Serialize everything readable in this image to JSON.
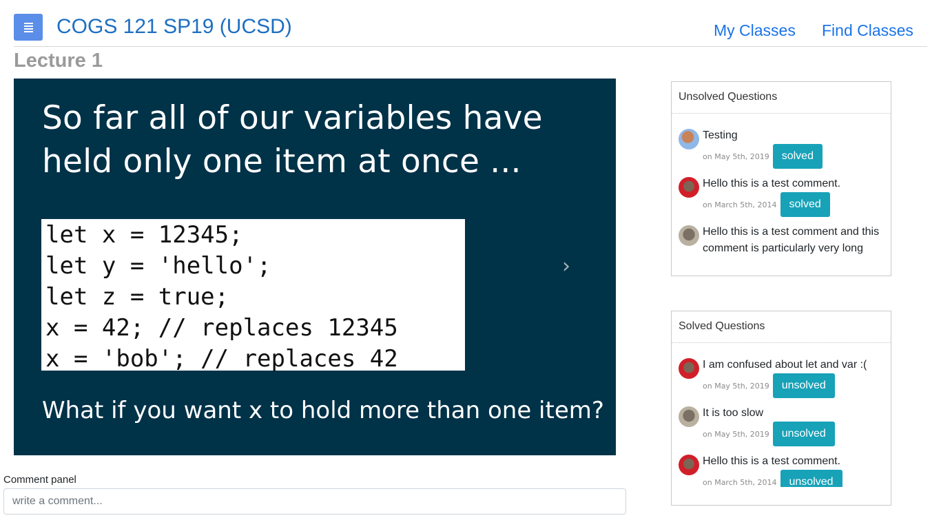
{
  "header": {
    "course_title": "COGS 121 SP19 (UCSD)",
    "nav": {
      "my_classes": "My Classes",
      "find_classes": "Find Classes"
    }
  },
  "lecture": {
    "title": "Lecture 1"
  },
  "slide": {
    "heading": "So far all of our variables have held only one item at once ...",
    "code_lines": [
      "let x = 12345;",
      "let y = 'hello';",
      "let z = true;",
      "x = 42; // replaces 12345",
      "x = 'bob'; // replaces 42"
    ],
    "question": "What if you want x to hold more than one item?",
    "next_icon": "chevron-right-icon"
  },
  "comment_panel": {
    "label": "Comment panel",
    "placeholder": "write a comment..."
  },
  "unsolved": {
    "title": "Unsolved Questions",
    "items": [
      {
        "text": "Testing",
        "date": "on May 5th, 2019",
        "button": "solved"
      },
      {
        "text": "Hello this is a test comment.",
        "date": "on March 5th, 2014",
        "button": "solved"
      },
      {
        "text": "Hello this is a test comment and this comment is particularly very long",
        "date": "",
        "button": ""
      }
    ]
  },
  "solved": {
    "title": "Solved Questions",
    "items": [
      {
        "text": "I am confused about let and var :(",
        "date": "on May 5th, 2019",
        "button": "unsolved"
      },
      {
        "text": "It is too slow",
        "date": "on May 5th, 2019",
        "button": "unsolved"
      },
      {
        "text": "Hello this is a test comment.",
        "date": "on March 5th, 2014",
        "button": "unsolved"
      }
    ]
  },
  "colors": {
    "brand_blue": "#1d6fc1",
    "menu_button": "#5b8ee8",
    "slide_bg": "#003248",
    "status_button": "#17a2b8"
  }
}
